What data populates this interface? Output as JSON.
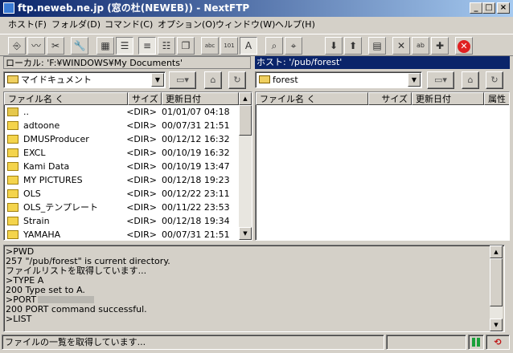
{
  "window": {
    "title": "ftp.neweb.ne.jp (窓の杜(NEWEB)) - NextFTP",
    "min": "_",
    "max": "□",
    "close": "×"
  },
  "menu": [
    "ホスト(F)",
    "フォルダ(D)",
    "コマンド(C)",
    "オプション(O)",
    "ウィンドウ(W)",
    "ヘルプ(H)"
  ],
  "toolbar": [
    {
      "icon": "connect-icon",
      "glyph": "⎆"
    },
    {
      "icon": "disconnect-icon",
      "glyph": "〰"
    },
    {
      "icon": "tools-icon",
      "glyph": "✂"
    },
    {
      "icon": "wrench-icon",
      "glyph": "🔧"
    },
    {
      "icon": "large-icons-view-icon",
      "glyph": "▦"
    },
    {
      "icon": "details-view-icon",
      "glyph": "☰"
    },
    {
      "icon": "list-view-icon",
      "glyph": "≡"
    },
    {
      "icon": "small-icons-view-icon",
      "glyph": "☷"
    },
    {
      "icon": "copy-icon",
      "glyph": "❐"
    },
    {
      "icon": "ascii-mode-icon",
      "glyph": "abc"
    },
    {
      "icon": "binary-mode-icon",
      "glyph": "101"
    },
    {
      "icon": "auto-mode-icon",
      "glyph": "A"
    },
    {
      "icon": "find-icon",
      "glyph": "⌕"
    },
    {
      "icon": "find-next-icon",
      "glyph": "⌖"
    },
    {
      "icon": "download-icon",
      "glyph": "⬇"
    },
    {
      "icon": "upload-icon",
      "glyph": "⬆"
    },
    {
      "icon": "properties-icon",
      "glyph": "▤"
    },
    {
      "icon": "delete-icon",
      "glyph": "✕"
    },
    {
      "icon": "rename-icon",
      "glyph": "ab"
    },
    {
      "icon": "new-folder-icon",
      "glyph": "✚"
    },
    {
      "icon": "stop-icon",
      "glyph": "✕"
    }
  ],
  "local": {
    "path": "ローカル: 'F:¥WINDOWS¥My Documents'",
    "combo": "マイドキュメント",
    "columns": {
      "name": "ファイル名 く",
      "size": "サイズ",
      "date": "更新日付"
    },
    "rows": [
      {
        "name": "..",
        "size": "<DIR>",
        "date": "01/01/07 04:18",
        "up": true
      },
      {
        "name": "adtoone",
        "size": "<DIR>",
        "date": "00/07/31 21:51"
      },
      {
        "name": "DMUSProducer",
        "size": "<DIR>",
        "date": "00/12/12 16:32"
      },
      {
        "name": "EXCL",
        "size": "<DIR>",
        "date": "00/10/19 16:32"
      },
      {
        "name": "Kami Data",
        "size": "<DIR>",
        "date": "00/10/19 13:47"
      },
      {
        "name": "MY PICTURES",
        "size": "<DIR>",
        "date": "00/12/18 19:23"
      },
      {
        "name": "OLS",
        "size": "<DIR>",
        "date": "00/12/22 23:11"
      },
      {
        "name": "OLS_テンプレート",
        "size": "<DIR>",
        "date": "00/11/22 23:53"
      },
      {
        "name": "Strain",
        "size": "<DIR>",
        "date": "00/12/18 19:34"
      },
      {
        "name": "YAMAHA",
        "size": "<DIR>",
        "date": "00/07/31 21:51"
      }
    ]
  },
  "remote": {
    "path": "ホスト: '/pub/forest'",
    "combo": "forest",
    "columns": {
      "name": "ファイル名 く",
      "size": "サイズ",
      "date": "更新日付",
      "attr": "属性"
    }
  },
  "log": [
    ">PWD",
    "257 \"/pub/forest\" is current directory.",
    "ファイルリストを取得しています...",
    ">TYPE A",
    "200 Type set to A.",
    ">PORT",
    "200 PORT command successful.",
    ">LIST"
  ],
  "status": {
    "text": "ファイルの一覧を取得しています..."
  }
}
